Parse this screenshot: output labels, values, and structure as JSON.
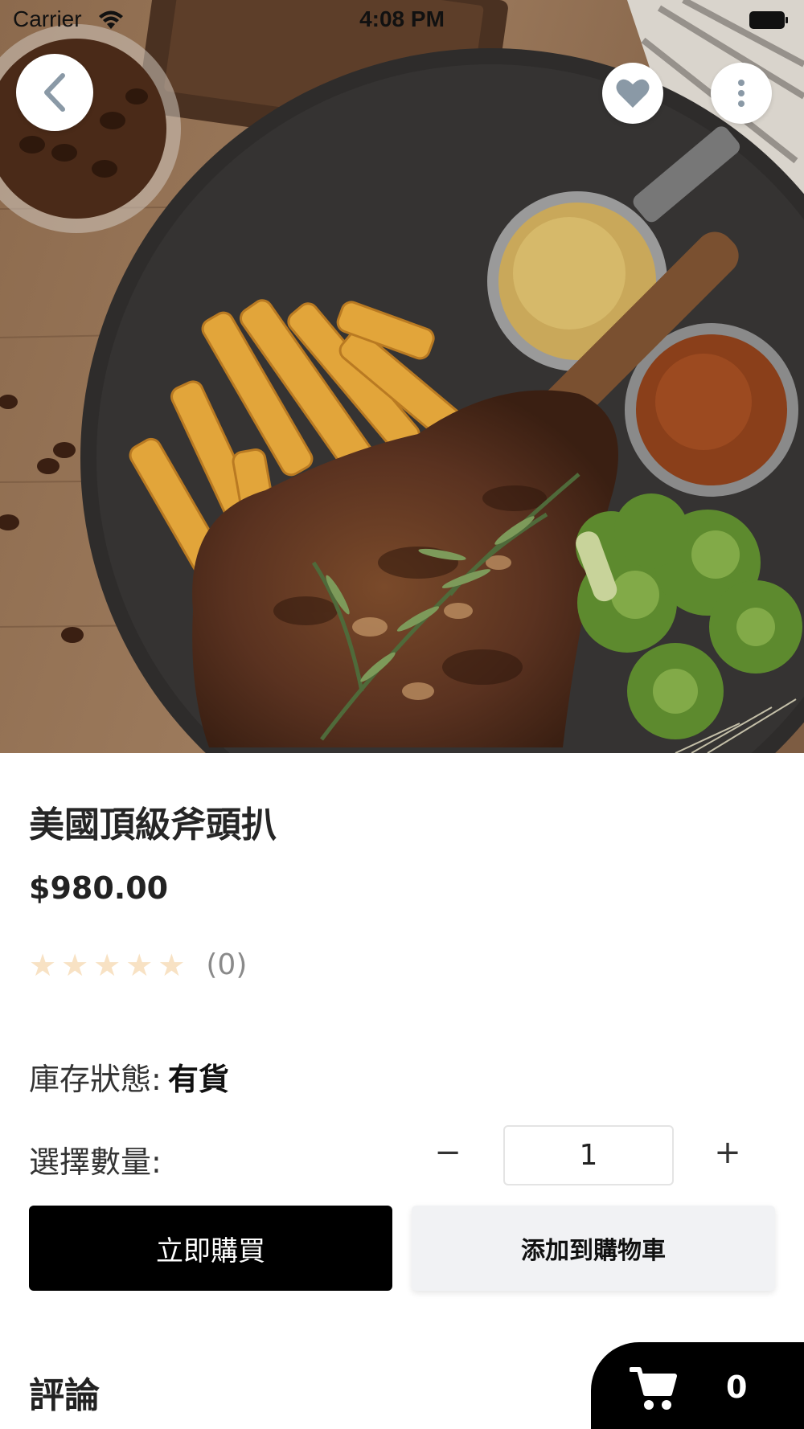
{
  "status_bar": {
    "carrier": "Carrier",
    "time": "4:08 PM"
  },
  "hero": {
    "icons": [
      "back-arrow-icon",
      "heart-icon",
      "more-vertical-icon"
    ],
    "background_color": "#7a5a40",
    "plate_color": "#2e2c2b"
  },
  "product": {
    "title": "美國頂級斧頭扒",
    "price": "$980.00",
    "rating_stars": "★★★★★",
    "rating_value": 0,
    "review_count": "(0)",
    "stock_label": "庫存狀態:",
    "stock_value": "有貨"
  },
  "quantity": {
    "label": "選擇數量:",
    "minus": "−",
    "value": "1",
    "plus": "+"
  },
  "actions": {
    "buy_now": "立即購買",
    "add_to_cart": "添加到購物車"
  },
  "reviews": {
    "title": "評論"
  },
  "cart": {
    "count": "0",
    "icon": "shopping-cart-icon"
  },
  "colors": {
    "star_empty": "#f8e2c4",
    "primary_button": "#000000",
    "secondary_button": "#f1f2f4",
    "icon_gray": "#8a99a6"
  }
}
